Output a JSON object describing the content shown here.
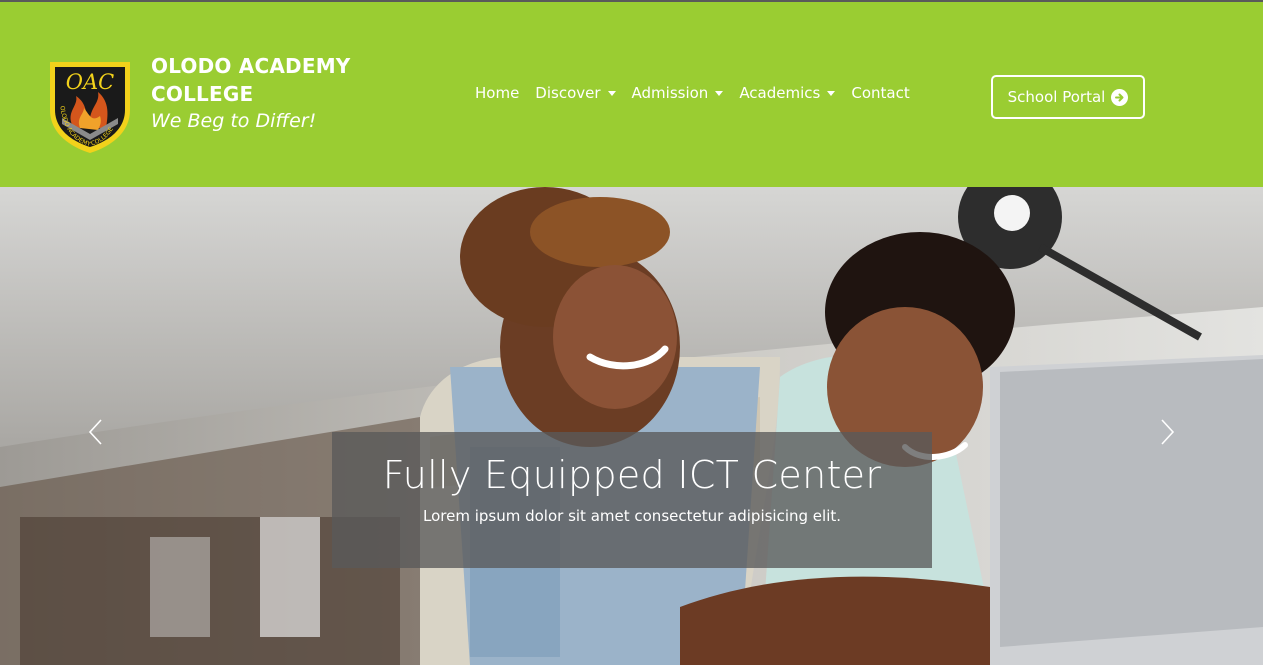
{
  "brand": {
    "logo_text": "OAC",
    "logo_ring_text": "OLODO ACADEMY COLLEGE",
    "name": "OLODO ACADEMY COLLEGE",
    "tagline": "We Beg to Differ!"
  },
  "nav": {
    "items": [
      {
        "label": "Home",
        "dropdown": false
      },
      {
        "label": "Discover",
        "dropdown": true
      },
      {
        "label": "Admission",
        "dropdown": true
      },
      {
        "label": "Academics",
        "dropdown": true
      },
      {
        "label": "Contact",
        "dropdown": false
      }
    ]
  },
  "portal": {
    "label": "School Portal",
    "icon": "arrow-circle-right-icon"
  },
  "carousel": {
    "slide": {
      "title": "Fully Equipped ICT Center",
      "text": "Lorem ipsum dolor sit amet consectetur adipisicing elit."
    },
    "prev_icon": "chevron-left-icon",
    "next_icon": "chevron-right-icon"
  },
  "colors": {
    "header_bg": "#9acd32",
    "logo_shield": "#1a1a1a",
    "logo_gold": "#f2d21b",
    "caption_bg": "#5a5a5a"
  }
}
